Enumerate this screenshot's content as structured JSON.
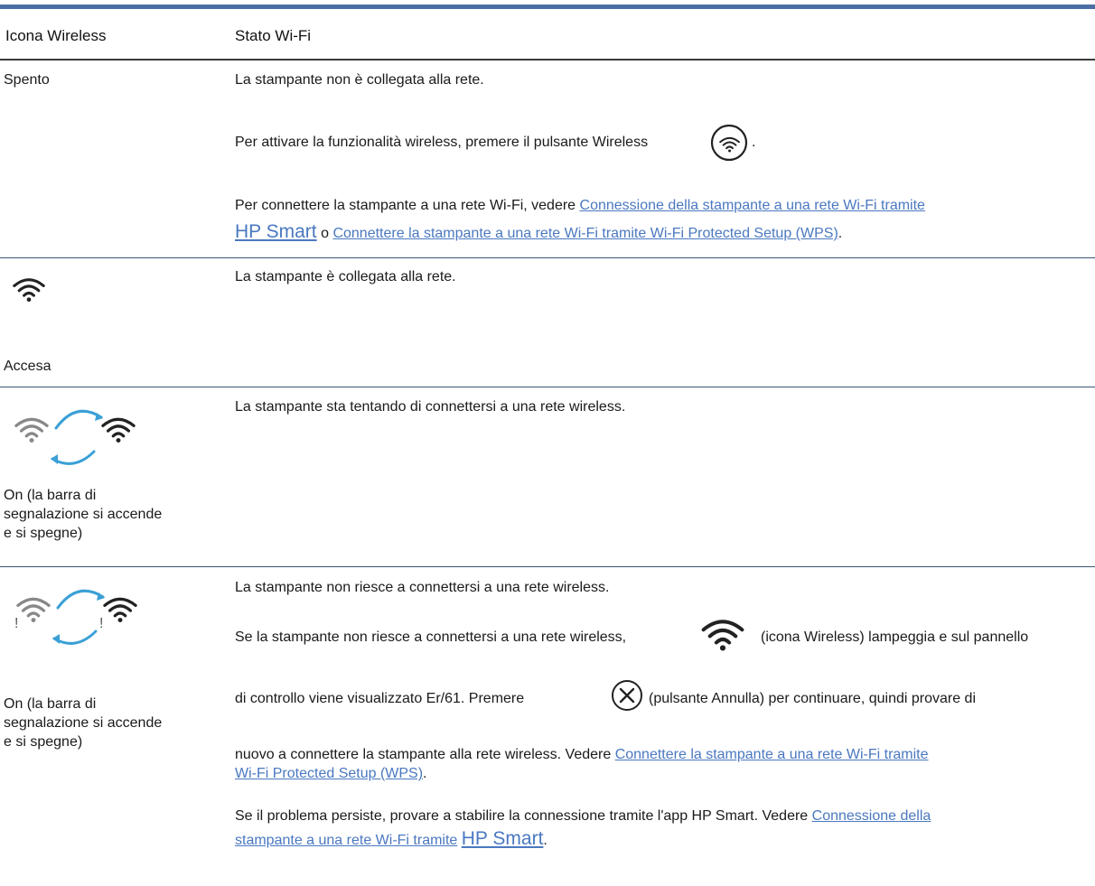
{
  "header": {
    "col1": "Icona Wireless",
    "col2": "Stato Wi-Fi"
  },
  "row1": {
    "status": "Spento",
    "p1": "La stampante non è collegata alla rete.",
    "p2_before": "Per attivare la funzionalità wireless, premere il pulsante Wireless",
    "p2_after": ".",
    "p3_before": "Per connettere la stampante a una rete Wi-Fi, vedere",
    "p3_link1": "Connessione della stampante a una rete Wi-Fi tramite",
    "p3_link1_big": "HP Smart",
    "p3_mid": "o",
    "p3_link2": "Connettere la stampante a una rete Wi-Fi tramite Wi-Fi Protected Setup (WPS)",
    "p3_after": "."
  },
  "row2": {
    "status": "Accesa",
    "p1": "La stampante è collegata alla rete."
  },
  "row3": {
    "status_l1": "On (la barra di",
    "status_l2": "segnalazione si accende",
    "status_l3": "e si spegne)",
    "p1": "La stampante sta tentando di connettersi a una rete wireless."
  },
  "row4": {
    "status_l1": "On (la barra di",
    "status_l2": "segnalazione si accende",
    "status_l3": "e si spegne)",
    "p1": "La stampante non riesce a connettersi a una rete wireless.",
    "p2_before": "Se la stampante non riesce a connettersi a una rete wireless,",
    "p2_after": "(icona Wireless) lampeggia e sul pannello",
    "p3_before": "di controllo viene visualizzato Er/61. Premere",
    "p3_after": "(pulsante Annulla) per continuare, quindi provare di",
    "p4": "nuovo a connettere la stampante alla rete wireless. Vedere",
    "p4_link_l1": "Connettere la stampante a una rete Wi-Fi tramite",
    "p4_link_l2": "Wi-Fi Protected Setup (WPS)",
    "p4_after": ".",
    "p5_before": "Se il problema persiste, provare a stabilire la connessione tramite l'app HP Smart. Vedere",
    "p5_link_l1": "Connessione della",
    "p5_link_l2": "stampante a una rete Wi-Fi tramite",
    "p5_link_big": "HP Smart",
    "p5_after": "."
  },
  "icons": [
    "wireless-button-icon",
    "wifi-icon",
    "wifi-cycle-icon",
    "wifi-error-cycle-icon",
    "cancel-button-icon"
  ]
}
